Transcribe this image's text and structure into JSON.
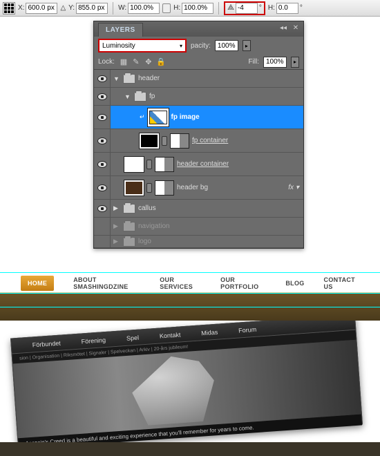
{
  "toolbar": {
    "x_label": "X:",
    "x_value": "600.0 px",
    "y_label": "Y:",
    "y_value": "855.0 px",
    "w_label": "W:",
    "w_value": "100.0%",
    "h_label": "H:",
    "h_value": "100.0%",
    "rotate_value": "-4",
    "rotate_unit": "°",
    "h2_label": "H:",
    "h2_value": "0.0",
    "h2_unit": "°"
  },
  "layers": {
    "tab": "LAYERS",
    "blend_mode": "Luminosity",
    "opacity_label": "pacity:",
    "opacity_value": "100%",
    "lock_label": "Lock:",
    "fill_label": "Fill:",
    "fill_value": "100%",
    "items": [
      {
        "name": "header"
      },
      {
        "name": "fp"
      },
      {
        "name": "fp image"
      },
      {
        "name": "fp container"
      },
      {
        "name": "header container"
      },
      {
        "name": "header bg"
      },
      {
        "name": "callus"
      },
      {
        "name": "navigation"
      },
      {
        "name": "logo"
      }
    ],
    "fx_label": "fx"
  },
  "preview": {
    "nav": [
      "HOME",
      "ABOUT SMASHINGDZINE",
      "OUR SERVICES",
      "OUR PORTFOLIO",
      "BLOG",
      "CONTACT US"
    ],
    "fp_nav": [
      "Förbundet",
      "Förening",
      "Spel",
      "Kontakt",
      "Midas",
      "Forum"
    ],
    "fp_subnav": "sion | Organisation | Riksmötet | Signaler | Spelveckan | Arkiv | 20-års jubileum!",
    "fp_caption": "Assasin's Creed is a beautiful and exciting experience that you'll remember for years to come."
  }
}
